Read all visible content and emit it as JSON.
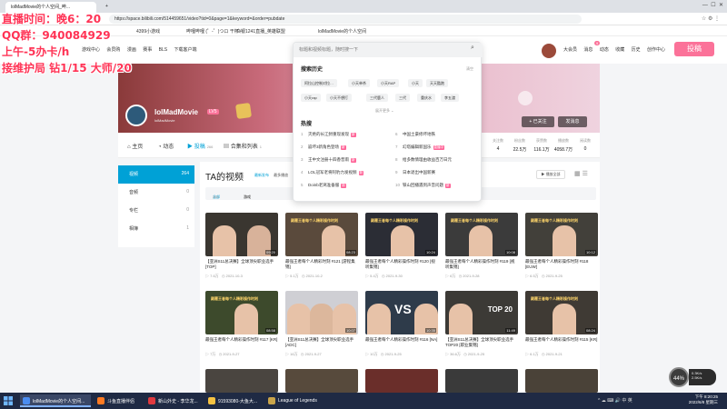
{
  "browser": {
    "tabs": [
      {
        "label": "lolMadMovie的个人空间_哔..."
      }
    ],
    "url": "https://space.bilibili.com/514459651/video?tid=0&page=1&keyword=&order=pubdate",
    "bookmarks": [
      "4399小游戏",
      "哔哩哔哩 (゜-゜)つロ 干杯~",
      "白银1241直播_英雄联盟",
      "lolMadMovie的个人空间"
    ]
  },
  "site": {
    "nav_left": [
      "游戏中心",
      "会员购",
      "漫画",
      "赛事",
      "BLS",
      "下载客户端"
    ],
    "nav_right": [
      "大会员",
      "消息",
      "动态",
      "收藏",
      "历史",
      "创作中心"
    ],
    "message_count": "9",
    "upload_label": "投稿"
  },
  "overlay": {
    "line1": "直播时间：晚6：20",
    "line2": "QQ群：940084929",
    "line3": "上午-5办卡/h",
    "line4": "接维护局 钻1/15 大师/20"
  },
  "search": {
    "placeholder": "标题和视频标题，随时搜一下",
    "history_heading": "搜索历史",
    "clear_label": "清空",
    "history": [
      "阿拉山控制对拉…",
      "小天单杀",
      "小天RAP",
      "小天",
      "天天酷跑",
      "小天rap",
      "小天不想打",
      "三代鹿人",
      "三代",
      "重庆水",
      "李五渡"
    ],
    "expand_label": "展开更多",
    "hot_heading": "热搜",
    "hot": [
      {
        "idx": "1",
        "text": "灭绝的长江鲟重现发现",
        "tag": "新"
      },
      {
        "idx": "2",
        "text": "崩坏3新角色登场",
        "tag": "新"
      },
      {
        "idx": "3",
        "text": "王中文注册十四香普雨",
        "tag": "新"
      },
      {
        "idx": "4",
        "text": "LOL冠军老将阿豹力发视频",
        "tag": "新"
      },
      {
        "idx": "5",
        "text": "Doinb老窝准备服",
        "tag": "新"
      },
      {
        "idx": "6",
        "text": "中国土豪修坏地铁",
        "tag": ""
      },
      {
        "idx": "7",
        "text": "幻塔编辑新国乐",
        "tag": "直播中"
      },
      {
        "idx": "8",
        "text": "给多数情理由收益百万日元",
        "tag": ""
      },
      {
        "idx": "9",
        "text": "日本退出中国新赛",
        "tag": ""
      },
      {
        "idx": "10",
        "text": "铁山回播遇到声音问题",
        "tag": "新"
      }
    ]
  },
  "channel": {
    "name": "lolMadMovie",
    "level": "LV5",
    "subtitle": "lolMadMovie",
    "follow_label": "+ 已关注",
    "message_label": "发消息",
    "tabs": [
      {
        "label": "主页",
        "count": ""
      },
      {
        "label": "动态",
        "count": ""
      },
      {
        "label": "投稿",
        "count": "266"
      },
      {
        "label": "合集和列表",
        "count": "1"
      }
    ],
    "stats": [
      {
        "label": "关注数",
        "value": "4"
      },
      {
        "label": "粉丝数",
        "value": "22.5万"
      },
      {
        "label": "获赞数",
        "value": "116.1万"
      },
      {
        "label": "播放数",
        "value": "4058.7万"
      },
      {
        "label": "阅读数",
        "value": "0"
      }
    ]
  },
  "sidebar": {
    "items": [
      {
        "label": "视频",
        "count": "264"
      },
      {
        "label": "音频",
        "count": "0"
      },
      {
        "label": "专栏",
        "count": "0"
      },
      {
        "label": "相簿",
        "count": "1"
      }
    ]
  },
  "videos_section": {
    "title": "TA的视频",
    "sort": [
      "最新发布",
      "最多播放",
      "最多收藏"
    ],
    "play_all": "播放全部",
    "filters": [
      {
        "label": "全部",
        "count": "264"
      },
      {
        "label": "游戏",
        "count": "264"
      }
    ]
  },
  "videos": [
    {
      "title": "【亚洲S11总决赛】全球顶尖职业选手 [TOP]",
      "plays": "7.6万",
      "date": "2021-10-3",
      "duration": "09:20",
      "caption": "颠覆王者每个人精彩操作时刻"
    },
    {
      "title": "最强王者每个人精彩时刻 #121 [游程集锦]",
      "plays": "5.1万",
      "date": "2021-10-2",
      "duration": "08:23",
      "caption": "颠覆王者每个人精彩操作时刻"
    },
    {
      "title": "最强王者每个人精彩操作时刻 #120 [视听集锦]",
      "plays": "5.4万",
      "date": "2021-9-30",
      "duration": "10:24",
      "caption": "颠覆王者每个人精彩操作时刻"
    },
    {
      "title": "最强王者每个人精彩操作时刻 #119 [视听集锦]",
      "plays": "6万",
      "date": "2021-9-28",
      "duration": "10:08",
      "caption": "颠覆王者每个人精彩操作时刻"
    },
    {
      "title": "最强王者每个人精彩操作时刻 #118 [EUW]",
      "plays": "6.5万",
      "date": "2021-9-25",
      "duration": "10:12",
      "caption": "颠覆王者每个人精彩操作时刻"
    },
    {
      "title": "最强王者每个人精彩操作时刻 #117 [KR]",
      "plays": "7万",
      "date": "2021-9-27",
      "duration": "08:58",
      "caption": "颠覆王者每个人精彩操作时刻"
    },
    {
      "title": "【亚洲S11总决赛】全球顶尖职业选手 [ADC]",
      "plays": "16万",
      "date": "2021-9-27",
      "duration": "10:07",
      "caption": ""
    },
    {
      "title": "最强王者每个人精彩操作时刻 #116 [NA]",
      "plays": "10万",
      "date": "2021-9-25",
      "duration": "10:35",
      "caption": ""
    },
    {
      "title": "【亚洲S11总决赛】全球顶尖职业选手 TOP20 [职业集锦]",
      "plays": "36.6万",
      "date": "2021-9-25",
      "duration": "11:49",
      "caption": "TOP 20"
    },
    {
      "title": "最强王者每个人精彩操作时刻 #115 [KR]",
      "plays": "6.1万",
      "date": "2021-9-21",
      "duration": "08:24",
      "caption": "颠覆王者每个人精彩操作时刻"
    }
  ],
  "speed_widget": {
    "percent": "44",
    "up": "0.3K/s",
    "down": "2.5K/s"
  },
  "taskbar": {
    "items": [
      "lolMadMovie的个人空间...",
      "斗鱼直播伴侣",
      "新山外史 - 李华龙...",
      "91593080-大鱼大...",
      "League of Legends"
    ],
    "tray": "^ ☁ ⌨ 🔊 中 英",
    "time": "下午 8:20:25",
    "date": "2022/6/8 星期三"
  },
  "colors": {
    "accent": "#00a1d6",
    "pink": "#fb7299",
    "overlay_text": "#ff3355",
    "taskbar": "#1f2a44"
  }
}
